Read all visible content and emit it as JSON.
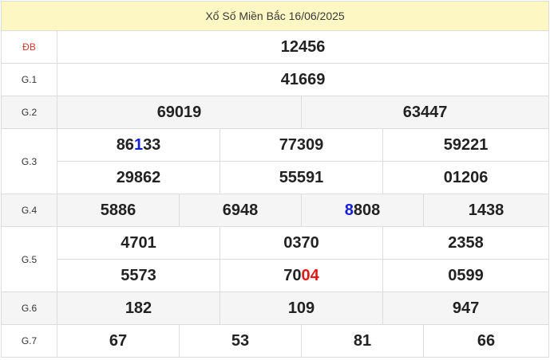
{
  "title": "Xổ Số Miền Bắc 16/06/2025",
  "prizes": {
    "db": {
      "label": "ĐB",
      "numbers": [
        "12456"
      ]
    },
    "g1": {
      "label": "G.1",
      "numbers": [
        "41669"
      ]
    },
    "g2": {
      "label": "G.2",
      "numbers": [
        "69019",
        "63447"
      ]
    },
    "g3": {
      "label": "G.3",
      "numbers": [
        {
          "pre": "86",
          "hl": "1",
          "post": "33"
        },
        "77309",
        "59221",
        "29862",
        "55591",
        "01206"
      ]
    },
    "g4": {
      "label": "G.4",
      "numbers": [
        "5886",
        "6948",
        {
          "pre": "",
          "hl": "8",
          "post": "808"
        },
        "1438"
      ]
    },
    "g5": {
      "label": "G.5",
      "numbers": [
        "4701",
        "0370",
        "2358",
        "5573",
        {
          "pre": "70",
          "hl": "04",
          "post": ""
        },
        "0599"
      ]
    },
    "g6": {
      "label": "G.6",
      "numbers": [
        "182",
        "109",
        "947"
      ]
    },
    "g7": {
      "label": "G.7",
      "numbers": [
        "67",
        "53",
        "81",
        "66"
      ]
    }
  },
  "colors": {
    "title_bg": "#fdf7c3",
    "special_label": "#d9342b",
    "highlight_blue": "#1420d6",
    "highlight_red": "#e01919"
  }
}
